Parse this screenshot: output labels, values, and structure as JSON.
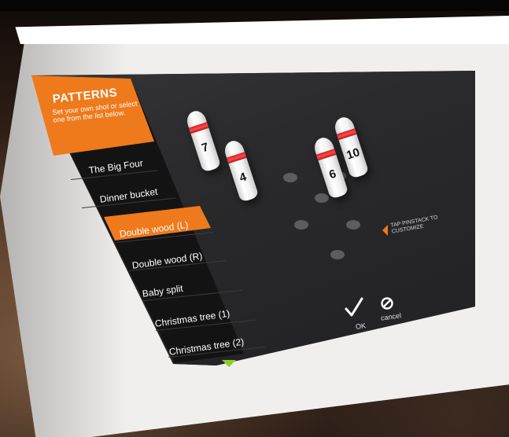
{
  "panel": {
    "title": "PATTERNS",
    "subtitle": "Set your own shot or select one from the list below."
  },
  "patterns": [
    {
      "label": "The Big Four",
      "selected": false
    },
    {
      "label": "Dinner bucket",
      "selected": false
    },
    {
      "label": "Double wood (L)",
      "selected": true
    },
    {
      "label": "Double wood (R)",
      "selected": false
    },
    {
      "label": "Baby split",
      "selected": false
    },
    {
      "label": "Christmas tree (1)",
      "selected": false
    },
    {
      "label": "Christmas tree (2)",
      "selected": false
    }
  ],
  "scroll_icon": "chevron-down-icon",
  "pins": [
    {
      "number": "7"
    },
    {
      "number": "4"
    },
    {
      "number": "6"
    },
    {
      "number": "10"
    }
  ],
  "hint": "TAP PINSTACK TO CUSTOMIZE",
  "actions": {
    "ok_label": "OK",
    "cancel_label": "cancel"
  },
  "colors": {
    "accent": "#ee7a1c",
    "sidebar": "#131313",
    "screen": "#2c2c2e",
    "pin_stripe": "#d02020",
    "scroll_arrow": "#8ccf2a"
  }
}
